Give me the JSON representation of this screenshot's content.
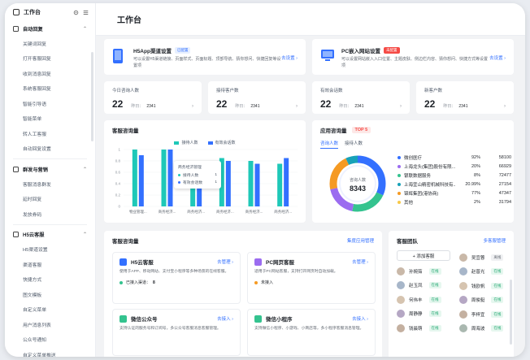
{
  "sidebar": {
    "title": "工作台",
    "groups": [
      {
        "label": "自动回复",
        "items": [
          "关键词回复",
          "打开客服回复",
          "收到消息回复",
          "系统客服回复",
          "智能引导语",
          "智能菜单",
          "转人工客服",
          "自动回复设置"
        ]
      },
      {
        "label": "群发与营销",
        "items": [
          "客服消息群发",
          "延时回复",
          "发放券码"
        ]
      },
      {
        "label": "H5云客服",
        "items": [
          "H5渠道设置",
          "渠道客服",
          "快捷方式",
          "图文模板",
          "自定义菜单",
          "用户消息列表",
          "公众号通知",
          "自定义菜单推送",
          "风险控制"
        ]
      }
    ]
  },
  "header": {
    "title": "工作台"
  },
  "setup": [
    {
      "title": "H5App渠道设置",
      "tag": "已配置",
      "desc": "可以设置H5渠道链接、页面样式、页面标题、顶部导航、猜你想问、快捷回复等设置项",
      "link": "去设置"
    },
    {
      "title": "PC嵌入网站设置",
      "tag": "未配置",
      "desc": "可以设置网站嵌入入口位置、主题皮肤、侧边栏内容、猜你想问、快捷方式等设置项",
      "link": "去设置"
    }
  ],
  "stats": [
    {
      "label": "今日咨询人数",
      "value": "22",
      "yesterday_label": "昨日：",
      "yesterday": "2341"
    },
    {
      "label": "接待客户数",
      "value": "22",
      "yesterday_label": "昨日：",
      "yesterday": "2341"
    },
    {
      "label": "有效会话数",
      "value": "22",
      "yesterday_label": "昨日：",
      "yesterday": "2341"
    },
    {
      "label": "新客户数",
      "value": "22",
      "yesterday_label": "昨日：",
      "yesterday": "2341"
    }
  ],
  "bar_section": {
    "title": "客服咨询量"
  },
  "tooltip": {
    "title": "商务经济管理",
    "rows": [
      {
        "name": "接待人数",
        "value": "1"
      },
      {
        "name": "有效会话数",
        "value": "1"
      }
    ]
  },
  "pie_section": {
    "title": "应用咨询量",
    "badge": "TOP 5",
    "tabs": [
      "咨询人数",
      "接待人数"
    ],
    "center_label": "咨询人数",
    "center_value": "8343"
  },
  "rank": [
    {
      "name": "微创医疗",
      "pct": "92%",
      "count": "58100",
      "color": "#3370ff"
    },
    {
      "name": "上海龙头(集团)股份有限...",
      "pct": "20%",
      "count": "66929",
      "color": "#9b6cf0"
    },
    {
      "name": "银联数据服务",
      "pct": "8%",
      "count": "72477",
      "color": "#34c38f"
    },
    {
      "name": "上海宜山精密机械科技有...",
      "pct": "20.99%",
      "count": "27154",
      "color": "#17a2b8"
    },
    {
      "name": "锦辉集团(港协商)",
      "pct": "77%",
      "count": "47347",
      "color": "#f59a23"
    },
    {
      "name": "其他",
      "pct": "2%",
      "count": "31794",
      "color": "#f7c948"
    }
  ],
  "svc_section": {
    "title": "客服咨询量",
    "link": "集度应用管理"
  },
  "services": [
    {
      "name": "H5云客服",
      "link": "去管理",
      "desc": "使用于APP、移动网站、支付宝小程序等多种场景的在线客服。",
      "status": "已接入渠道：",
      "status_val": "8",
      "color": "#3370ff",
      "dot": "#34c38f"
    },
    {
      "name": "PC网页客服",
      "link": "去管理",
      "desc": "适用于PC网站客服，支持打开网页时自动加载。",
      "status": "未接入",
      "status_val": "",
      "color": "#9b6cf0",
      "dot": "#f59a23"
    },
    {
      "name": "微信公众号",
      "link": "去接入",
      "desc": "支持认证的服务号和订阅号，多公众号客服消息客服管理。",
      "status": "",
      "status_val": "",
      "color": "#34c38f",
      "dot": "#34c38f"
    },
    {
      "name": "微信小程序",
      "link": "去接入",
      "desc": "支持微信小程序、小游戏、小商店等，多小程序客服消息管理。",
      "status": "",
      "status_val": "",
      "color": "#34c38f",
      "dot": "#34c38f"
    }
  ],
  "team": {
    "title": "客服团队",
    "link": "多客服管理",
    "add_label": "+ 添加客服",
    "online": "在线",
    "offline": "离线",
    "left": [
      {
        "name": "孙婉茹",
        "status": "在线"
      },
      {
        "name": "赵玉凤",
        "status": "在线"
      },
      {
        "name": "何伟丰",
        "status": "在线"
      },
      {
        "name": "周静静",
        "status": "在线"
      },
      {
        "name": "钱晨萌",
        "status": "在线"
      }
    ],
    "right": [
      {
        "name": "吴宜蓉",
        "status": "离线"
      },
      {
        "name": "赵普光",
        "status": "在线"
      },
      {
        "name": "钱欧帆",
        "status": "在线"
      },
      {
        "name": "周俊艇",
        "status": "在线"
      },
      {
        "name": "李梓宜",
        "status": "在线"
      },
      {
        "name": "周海波",
        "status": "在线"
      }
    ]
  },
  "chart_data": {
    "type": "bar",
    "categories": [
      "物业管理...",
      "商务经济...",
      "商务经济...",
      "商务经济...",
      "商务经济...",
      "商务经济..."
    ],
    "series": [
      {
        "name": "接待人数",
        "values": [
          1,
          1,
          0.8,
          0.85,
          0.8,
          0.75
        ],
        "color": "#1ec8b8"
      },
      {
        "name": "有效会话数",
        "values": [
          0.9,
          1,
          0.75,
          0.8,
          0.75,
          0.85
        ],
        "color": "#3370ff"
      }
    ],
    "ylim": [
      0,
      1
    ],
    "yticks": [
      "1",
      "0.8",
      "0.6",
      "0.4",
      "0.2",
      "0"
    ]
  }
}
